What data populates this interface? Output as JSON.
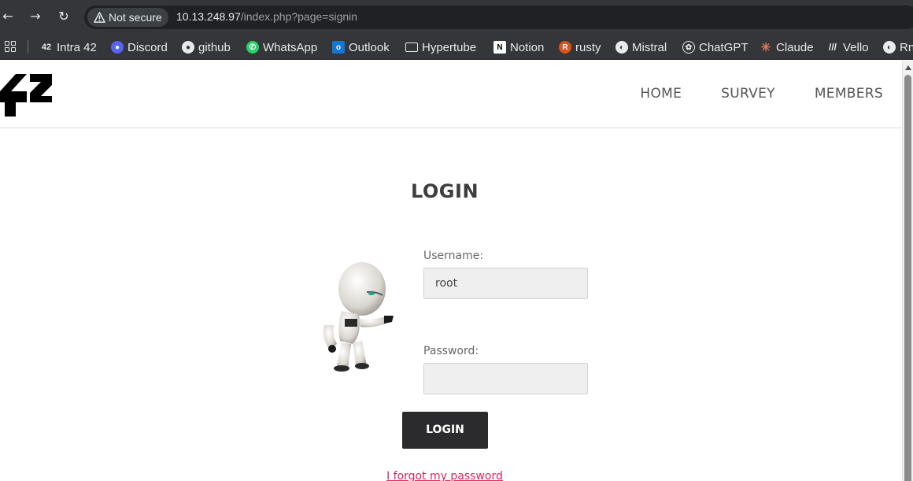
{
  "browser": {
    "security_label": "Not secure",
    "url_host": "10.13.248.97",
    "url_path": "/index.php?page=signin",
    "bookmarks": [
      {
        "label": "Intra 42",
        "icon": "42-icon"
      },
      {
        "label": "Discord",
        "icon": "discord-icon"
      },
      {
        "label": "github",
        "icon": "github-icon"
      },
      {
        "label": "WhatsApp",
        "icon": "whatsapp-icon"
      },
      {
        "label": "Outlook",
        "icon": "outlook-icon"
      },
      {
        "label": "Hypertube",
        "icon": "folder-icon"
      },
      {
        "label": "Notion",
        "icon": "notion-icon"
      },
      {
        "label": "rusty",
        "icon": "rust-icon"
      },
      {
        "label": "Mistral",
        "icon": "globe-icon"
      },
      {
        "label": "ChatGPT",
        "icon": "chatgpt-icon"
      },
      {
        "label": "Claude",
        "icon": "claude-icon"
      },
      {
        "label": "Vello",
        "icon": "vello-icon"
      },
      {
        "label": "Rn",
        "icon": "globe-icon"
      }
    ]
  },
  "header": {
    "nav": [
      "HOME",
      "SURVEY",
      "MEMBERS"
    ]
  },
  "main": {
    "title": "LOGIN",
    "username_label": "Username:",
    "username_value": "root",
    "password_label": "Password:",
    "password_value": "",
    "submit_label": "LOGIN",
    "forgot_link": "I forgot my password"
  },
  "colors": {
    "chrome": "#35363a",
    "button": "#2b2b2e",
    "link": "#e0245e"
  }
}
